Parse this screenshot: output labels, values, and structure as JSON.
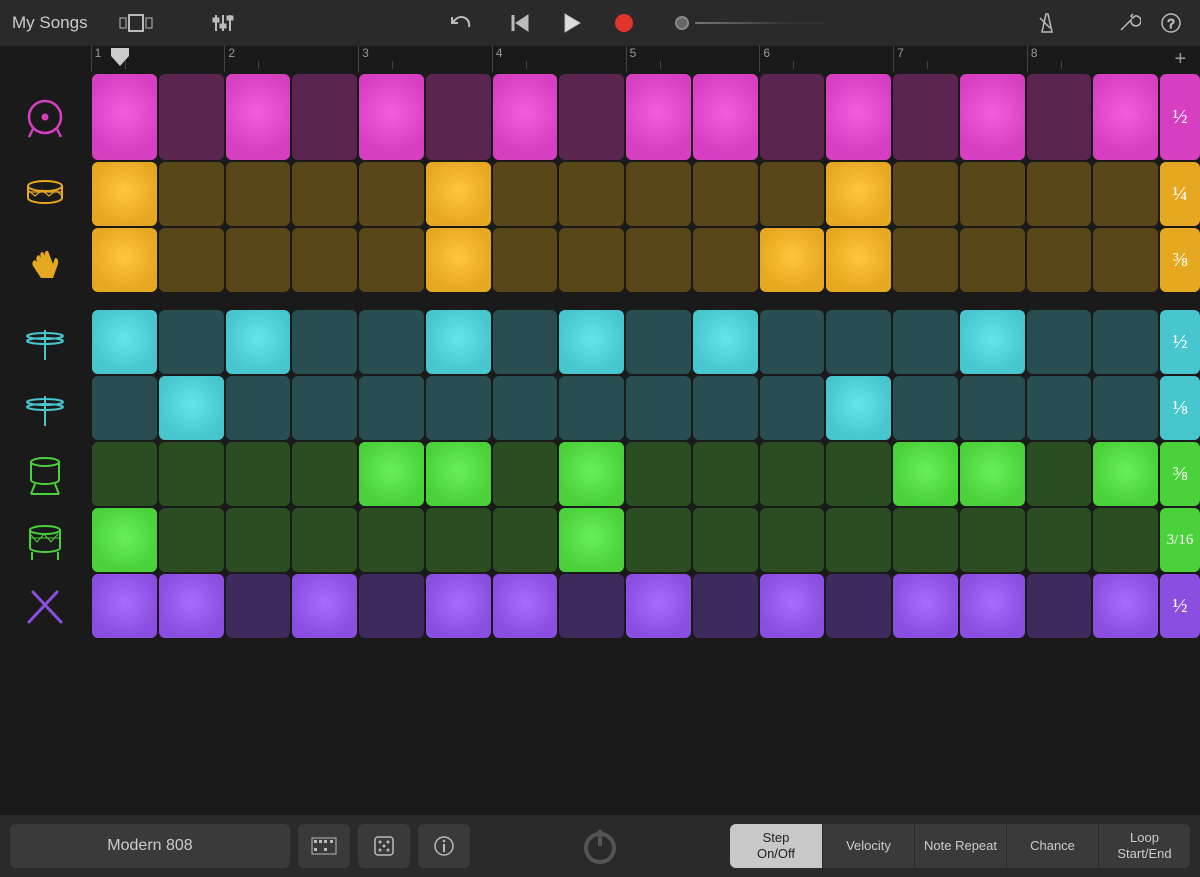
{
  "header": {
    "title": "My Songs"
  },
  "ruler": {
    "bars": [
      "1",
      "2",
      "3",
      "4",
      "5",
      "6",
      "7",
      "8"
    ]
  },
  "colors": {
    "kick_on": "#d63fc0",
    "kick_off": "#5a2550",
    "snare_on": "#e6a820",
    "snare_off": "#5a4719",
    "clap_on": "#e6a820",
    "clap_off": "#5a4719",
    "hihat_on": "#47c6ce",
    "hihat_off": "#284e52",
    "hihat2_on": "#47c6ce",
    "hihat2_off": "#284e52",
    "tom_on": "#4bd23a",
    "tom_off": "#2a4e22",
    "tom2_on": "#4bd23a",
    "tom2_off": "#2a4e22",
    "stick_on": "#8a4fe0",
    "stick_off": "#3f2a5e"
  },
  "tracks": [
    {
      "id": "kick",
      "instrument": "kick-drum-icon",
      "icon_color": "#d63fc0",
      "fraction": "½",
      "pattern": [
        1,
        0,
        1,
        0,
        1,
        0,
        1,
        0,
        1,
        1,
        0,
        1,
        0,
        1,
        0,
        1
      ]
    },
    {
      "id": "snare",
      "instrument": "snare-drum-icon",
      "icon_color": "#e6a820",
      "fraction": "¼",
      "slim": true,
      "pattern": [
        1,
        0,
        0,
        0,
        0,
        1,
        0,
        0,
        0,
        0,
        0,
        1,
        0,
        0,
        0,
        0
      ]
    },
    {
      "id": "clap",
      "instrument": "clap-icon",
      "icon_color": "#e6a820",
      "fraction": "⅜",
      "slim": true,
      "pattern": [
        1,
        0,
        0,
        0,
        0,
        1,
        0,
        0,
        0,
        0,
        1,
        1,
        0,
        0,
        0,
        0
      ]
    },
    {
      "id": "hihat",
      "instrument": "hihat-icon",
      "icon_color": "#47c6ce",
      "fraction": "½",
      "slim": true,
      "gap_before": true,
      "pattern": [
        1,
        0,
        1,
        0,
        0,
        1,
        0,
        1,
        0,
        1,
        0,
        0,
        0,
        1,
        0,
        0
      ]
    },
    {
      "id": "hihat2",
      "instrument": "hihat-icon",
      "icon_color": "#47c6ce",
      "fraction": "⅛",
      "slim": true,
      "pattern": [
        0,
        1,
        0,
        0,
        0,
        0,
        0,
        0,
        0,
        0,
        0,
        1,
        0,
        0,
        0,
        0
      ]
    },
    {
      "id": "tom",
      "instrument": "tom-icon",
      "icon_color": "#4bd23a",
      "fraction": "⅜",
      "slim": true,
      "pattern": [
        0,
        0,
        0,
        0,
        1,
        1,
        0,
        1,
        0,
        0,
        0,
        0,
        1,
        1,
        0,
        1
      ]
    },
    {
      "id": "tom2",
      "instrument": "floor-tom-icon",
      "icon_color": "#4bd23a",
      "fraction": "3/16",
      "slim": true,
      "pattern": [
        1,
        0,
        0,
        0,
        0,
        0,
        0,
        1,
        0,
        0,
        0,
        0,
        0,
        0,
        0,
        0
      ]
    },
    {
      "id": "stick",
      "instrument": "sticks-icon",
      "icon_color": "#8a4fe0",
      "fraction": "½",
      "slim": true,
      "pattern": [
        1,
        1,
        0,
        1,
        0,
        1,
        1,
        0,
        1,
        0,
        1,
        0,
        1,
        1,
        0,
        1
      ]
    }
  ],
  "bottom": {
    "kit_name": "Modern 808",
    "modes": [
      {
        "label": "Step\nOn/Off",
        "active": true
      },
      {
        "label": "Velocity",
        "active": false
      },
      {
        "label": "Note Repeat",
        "active": false
      },
      {
        "label": "Chance",
        "active": false
      },
      {
        "label": "Loop\nStart/End",
        "active": false
      }
    ]
  }
}
